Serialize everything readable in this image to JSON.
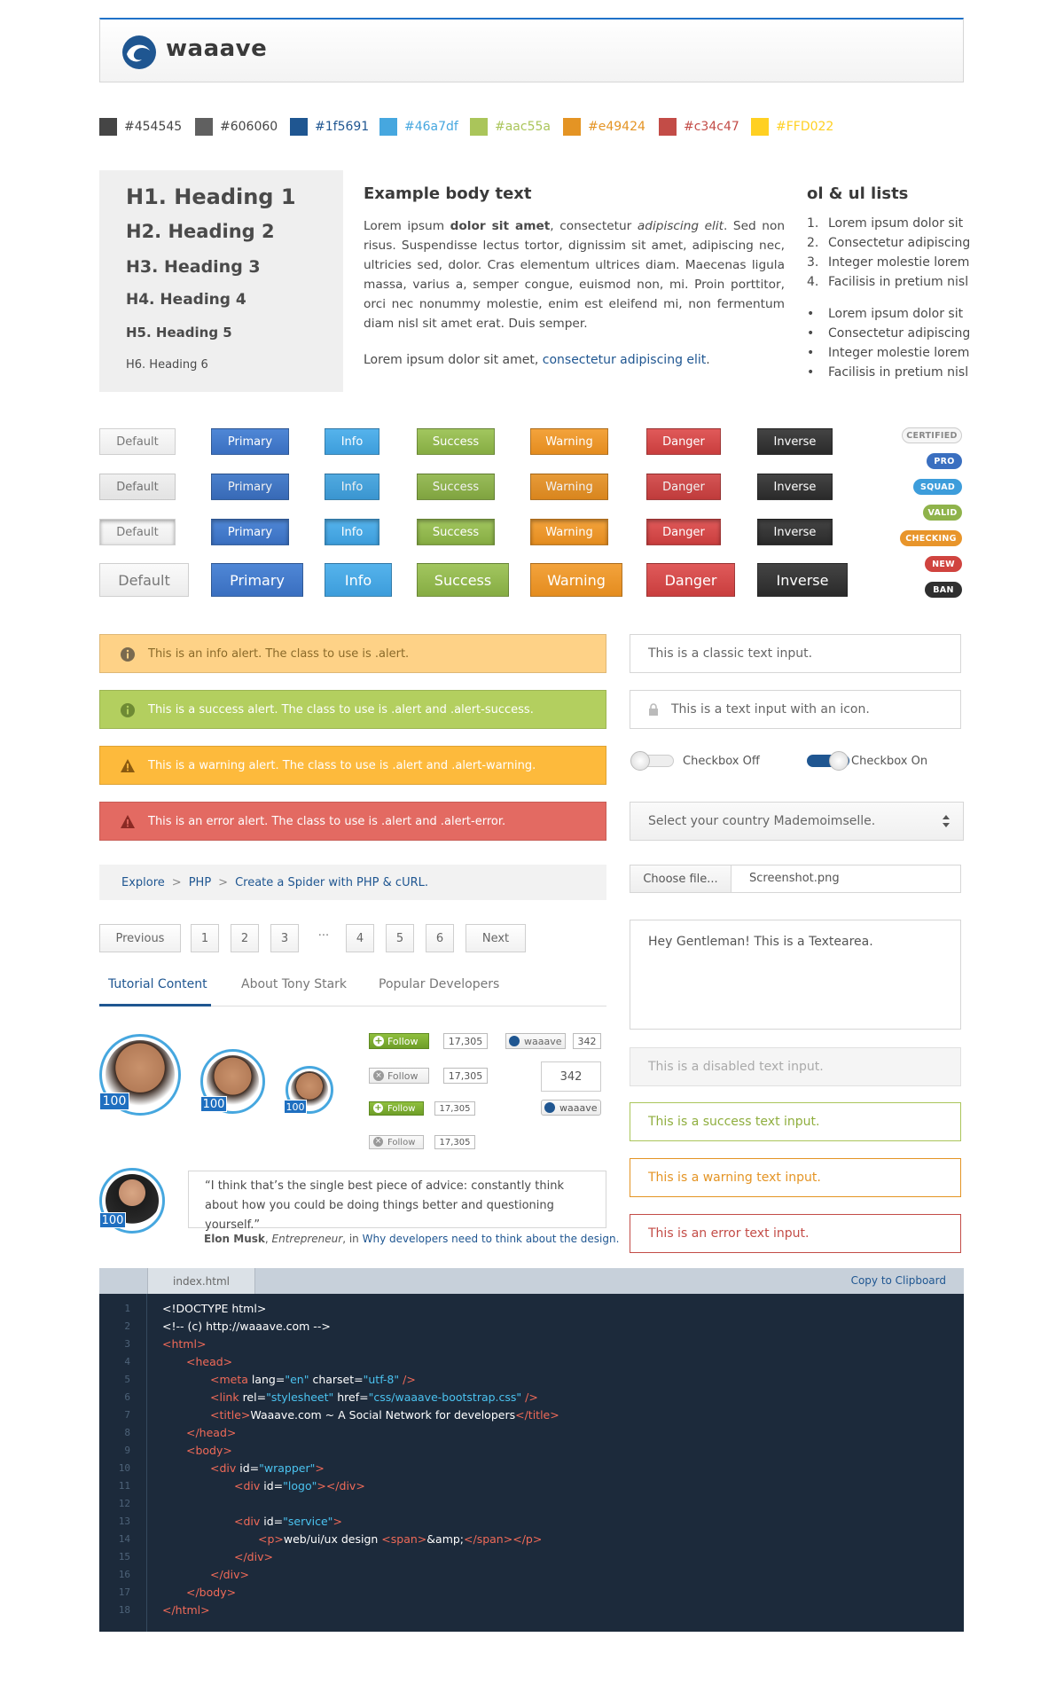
{
  "brand": {
    "name": "waaave"
  },
  "swatches": [
    {
      "label": "#454545",
      "color": "#454545"
    },
    {
      "label": "#606060",
      "color": "#606060"
    },
    {
      "label": "#1f5691",
      "color": "#1f5691"
    },
    {
      "label": "#46a7df",
      "color": "#46a7df"
    },
    {
      "label": "#aac55a",
      "color": "#aac55a"
    },
    {
      "label": "#e49424",
      "color": "#e49424"
    },
    {
      "label": "#c34c47",
      "color": "#c34c47"
    },
    {
      "label": "#FFD022",
      "color": "#FFD022"
    }
  ],
  "headings": [
    "H1. Heading 1",
    "H2. Heading 2",
    "H3. Heading 3",
    "H4. Heading 4",
    "H5. Heading 5",
    "H6. Heading 6"
  ],
  "body_text": {
    "title": "Example body text",
    "p1_a": "Lorem ipsum ",
    "p1_b": "dolor sit amet",
    "p1_c": ", consectetur ",
    "p1_d": "adipiscing elit",
    "p1_e": ". Sed non risus. Suspendisse lectus tortor, dignissim sit amet, adipiscing nec, ultricies sed, dolor. Cras elementum ultrices diam. Maecenas ligula massa, varius a, semper congue, euismod non, mi. Proin porttitor, orci nec nonummy molestie, enim est eleifend mi, non fermentum diam nisl sit amet erat. Duis semper.",
    "p2_a": "Lorem ipsum dolor sit amet, ",
    "p2_link": "consectetur adipiscing elit",
    "p2_end": "."
  },
  "lists": {
    "title": "ol & ul lists",
    "ol": [
      "Lorem ipsum dolor sit",
      "Consectetur adipiscing",
      "Integer molestie lorem",
      "Facilisis in pretium nisl"
    ],
    "ol_markers": [
      "1.",
      "2.",
      "3.",
      "4."
    ],
    "ul": [
      "Lorem ipsum dolor sit",
      "Consectetur adipiscing",
      "Integer molestie lorem",
      "Facilisis in pretium nisl"
    ],
    "ul_marker": "•"
  },
  "buttons": [
    "Default",
    "Primary",
    "Info",
    "Success",
    "Warning",
    "Danger",
    "Inverse"
  ],
  "badges": [
    "CERTIFIED",
    "PRO",
    "SQUAD",
    "VALID",
    "CHECKING",
    "NEW",
    "BAN"
  ],
  "alerts": [
    {
      "text": "This is an info alert. The class to use is .alert.",
      "icon": "info-icon"
    },
    {
      "text": "This is a success alert. The class to use is .alert and .alert-success.",
      "icon": "info-icon"
    },
    {
      "text": "This is a warning alert. The class to use is .alert and .alert-warning.",
      "icon": "warning-icon"
    },
    {
      "text": "This is an error alert. The class to use is .alert and .alert-error.",
      "icon": "warning-icon"
    }
  ],
  "inputs": {
    "classic": "This is a classic text input.",
    "icon": "This is a text input with an icon.",
    "checkbox_off": "Checkbox Off",
    "checkbox_on": "Checkbox On",
    "select": "Select your country Mademoimselle.",
    "file_button": "Choose file...",
    "file_name": "Screenshot.png",
    "textarea": "Hey Gentleman! This is a Textearea.",
    "disabled": "This is a disabled text input.",
    "success": "This is a success text input.",
    "warning": "This is a warning text input.",
    "error": "This is an error text input."
  },
  "breadcrumb": {
    "items": [
      "Explore",
      "PHP",
      "Create a Spider with PHP & cURL."
    ],
    "sep": ">"
  },
  "pagination": {
    "prev": "Previous",
    "next": "Next",
    "pages": [
      "1",
      "2",
      "3",
      "···",
      "4",
      "5",
      "6"
    ]
  },
  "tabs": [
    "Tutorial Content",
    "About Tony Stark",
    "Popular Developers"
  ],
  "avatars": {
    "score": "100"
  },
  "follow": {
    "label": "Follow",
    "count": "17,305",
    "waaave_label": "waaave",
    "waaave_count": "342"
  },
  "quote": {
    "text": "“I think that’s the single best piece of advice: constantly think about how you could be doing things better and questioning yourself.”",
    "author": "Elon Musk",
    "role": "Entrepreneur",
    "in": ", in ",
    "link": "Why developers need to think about the design.",
    "score": "100"
  },
  "code": {
    "filename": "index.html",
    "copy": "Copy to Clipboard",
    "line_numbers": [
      "1",
      "2",
      "3",
      "4",
      "5",
      "6",
      "7",
      "8",
      "9",
      "10",
      "11",
      "12",
      "13",
      "14",
      "15",
      "16",
      "17",
      "18"
    ],
    "l1": "<!DOCTYPE html>",
    "l2": "<!-- (c) http://waaave.com -->",
    "l3": "<html>",
    "l4": "<head>",
    "l5_tag": "<meta ",
    "l5_a1": "lang=",
    "l5_v1": "\"en\"",
    "l5_a2": " charset=",
    "l5_v2": "\"utf-8\"",
    "l5_end": " />",
    "l6_tag": "<link ",
    "l6_a1": "rel=",
    "l6_v1": "\"stylesheet\"",
    "l6_a2": " href=",
    "l6_v2": "\"css/waaave-bootstrap.css\"",
    "l6_end": " />",
    "l7_open": "<title>",
    "l7_text": "Waaave.com ~ A Social Network for developers",
    "l7_close": "</title>",
    "l8": "</head>",
    "l9": "<body>",
    "l10_tag": "<div ",
    "l10_a": "id=",
    "l10_v": "\"wrapper\"",
    "l10_end": ">",
    "l11_tag": "<div ",
    "l11_a": "id=",
    "l11_v": "\"logo\"",
    "l11_end": "></div>",
    "l13_tag": "<div ",
    "l13_a": "id=",
    "l13_v": "\"service\"",
    "l13_end": ">",
    "l14_open": "<p>",
    "l14_text": "web/ui/ux design ",
    "l14_span": "<span>",
    "l14_amp": "&amp;",
    "l14_spanc": "</span>",
    "l14_close": "</p>",
    "l15": "</div>",
    "l16": "</div>",
    "l17": "</body>",
    "l18": "</html>"
  }
}
